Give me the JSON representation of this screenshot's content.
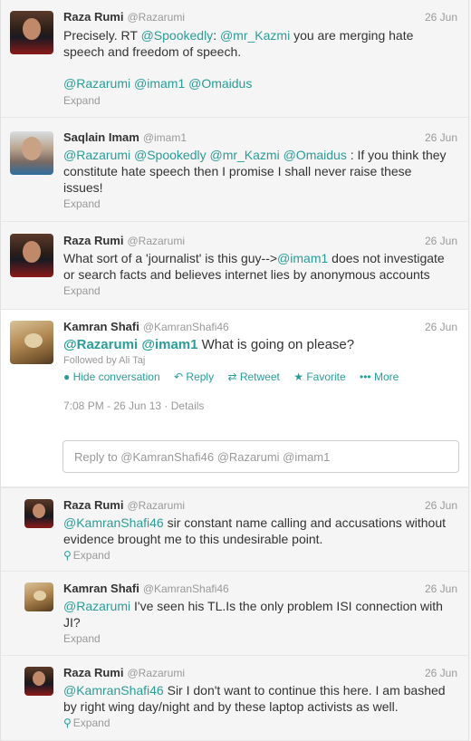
{
  "tweets": [
    {
      "name": "Raza Rumi",
      "handle": "@Razarumi",
      "date": "26 Jun",
      "line1_pre": "Precisely. RT ",
      "line1_m1": "@Spookedly",
      "line1_mid": ": ",
      "line1_m2": "@mr_Kazmi",
      "line1_post": " you are merging hate",
      "line2": "speech and freedom of speech.",
      "mentions": "@Razarumi @imam1 @Omaidus",
      "expand": "Expand"
    },
    {
      "name": "Saqlain Imam",
      "handle": "@imam1",
      "date": "26 Jun",
      "line1_mentions": "@Razarumi @Spookedly @mr_Kazmi @Omaidus",
      "line1_post": " : If you think they",
      "line2": "constitute hate speech then I promise I shall never raise these",
      "line3": "issues!",
      "expand": "Expand"
    },
    {
      "name": "Raza Rumi",
      "handle": "@Razarumi",
      "date": "26 Jun",
      "line1_pre": "What sort of a 'journalist' is this guy-->",
      "line1_m": "@imam1",
      "line1_post": " does not investigate",
      "line2": "or search facts and believes internet lies by anonymous accounts",
      "expand": "Expand"
    },
    {
      "name": "Kamran Shafi",
      "handle": "@KamranShafi46",
      "date": "26 Jun",
      "m1": "@Razarumi",
      "m2": "@imam1",
      "text": " What is going on please?",
      "followed": "Followed by Ali Taj",
      "actions": {
        "hide": "Hide conversation",
        "reply": "Reply",
        "retweet": "Retweet",
        "favorite": "Favorite",
        "more": "More"
      },
      "timestamp": "7:08 PM - 26 Jun 13",
      "details": "Details"
    }
  ],
  "reply_box": {
    "placeholder": "Reply to @KamranShafi46 @Razarumi @imam1"
  },
  "replies": [
    {
      "name": "Raza Rumi",
      "handle": "@Razarumi",
      "date": "26 Jun",
      "m": "@KamranShafi46",
      "line1_post": " sir constant name calling and accusations without",
      "line2": "evidence brought me to this undesirable point.",
      "expand": "Expand"
    },
    {
      "name": "Kamran Shafi",
      "handle": "@KamranShafi46",
      "date": "26 Jun",
      "m": "@Razarumi",
      "line1_post": " I've seen his TL.Is the only problem ISI connection with",
      "line2": "JI?",
      "expand": "Expand"
    },
    {
      "name": "Raza Rumi",
      "handle": "@Razarumi",
      "date": "26 Jun",
      "m": "@KamranShafi46",
      "line1_post": "  Sir I don't want to continue this here. I am bashed",
      "line2": "by right wing day/night and by these laptop activists as well.",
      "expand": "Expand"
    }
  ]
}
